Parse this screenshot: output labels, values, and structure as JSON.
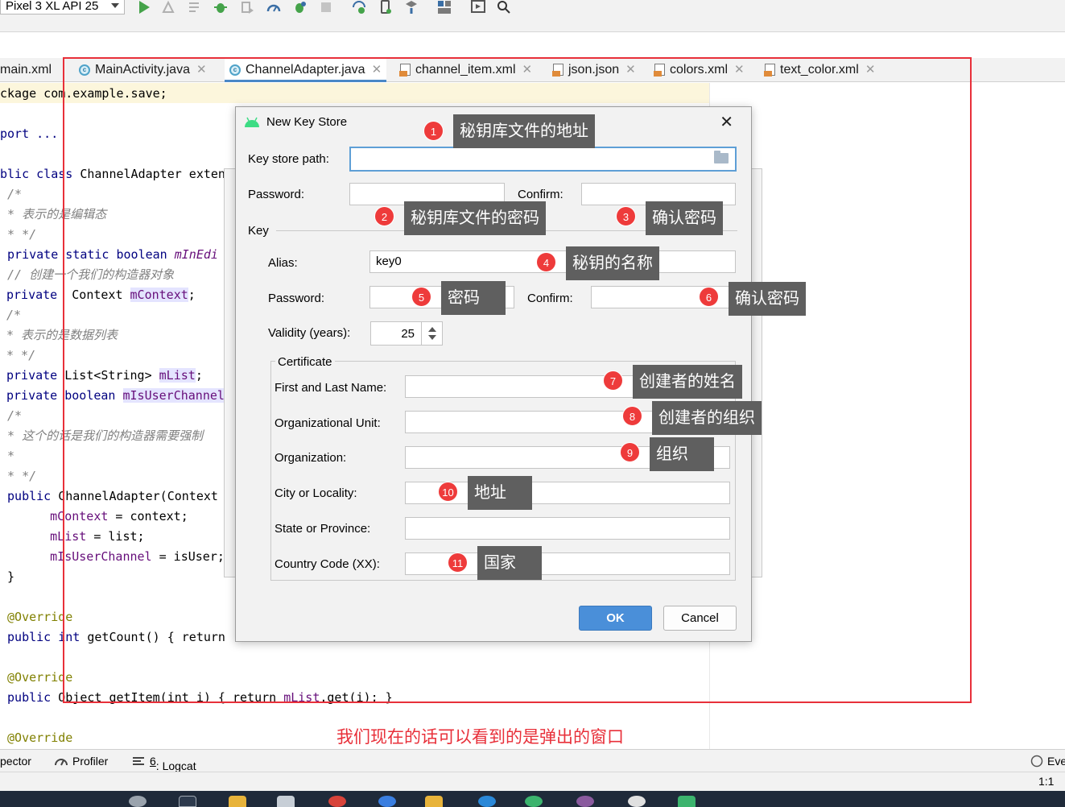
{
  "toolbar": {
    "device": "Pixel 3 XL API 25"
  },
  "tabs": [
    {
      "label": "main.xml",
      "icon": "xml-file-icon"
    },
    {
      "label": "MainActivity.java",
      "icon": "class-icon"
    },
    {
      "label": "ChannelAdapter.java",
      "icon": "class-icon",
      "active": true
    },
    {
      "label": "channel_item.xml",
      "icon": "xml-file-icon"
    },
    {
      "label": "json.json",
      "icon": "json-file-icon"
    },
    {
      "label": "colors.xml",
      "icon": "xml-file-icon"
    },
    {
      "label": "text_color.xml",
      "icon": "xml-file-icon"
    }
  ],
  "code": {
    "l1": "ckage com.example.save;",
    "l2": "port ...",
    "l3a": "blic class ",
    "l3b": "ChannelAdapter exten",
    "l4": " /*",
    "l5": " * 表示的是编辑态",
    "l6": " * */",
    "l7a": " private static boolean ",
    "l7b": "mInEdi",
    "l8": " // 创建一个我们的构造器对象",
    "l9a": "private ",
    "l9b": " Context ",
    "l9c": "mContext",
    "l9d": ";",
    "l10": "/*",
    "l11": "* 表示的是数据列表",
    "l12": "* */",
    "l13a": "private ",
    "l13b": "List<String> ",
    "l13c": "mList",
    "l13d": ";",
    "l14a": "private boolean ",
    "l14b": "mIsUserChannel",
    "l15": " /*",
    "l16": " * 这个的话是我们的构造器需要强制",
    "l17": " *",
    "l18": " * */",
    "l19a": " public ",
    "l19b": "ChannelAdapter(Context",
    "l20a": "     mContext",
    "l20b": " = context;",
    "l21a": "     mList",
    "l21b": " = list;",
    "l22a": "     mIsUserChannel",
    "l22b": " = isUser;",
    "l23": " }",
    "l24": " @Override",
    "l25a": " public int ",
    "l25b": "getCount() { return ",
    "l26": " @Override",
    "l27a": " public ",
    "l27b": "Object getItem(int i) { return ",
    "l27c": "mList",
    "l27d": ".get(i); }",
    "l28": " @Override"
  },
  "dialog": {
    "title": "New Key Store",
    "keystore_path_label": "Key store path:",
    "keystore_path_value": "",
    "password_label": "Password:",
    "confirm_label": "Confirm:",
    "key_section": "Key",
    "alias_label": "Alias:",
    "alias_value": "key0",
    "key_password_label": "Password:",
    "key_confirm_label": "Confirm:",
    "validity_label": "Validity (years):",
    "validity_value": "25",
    "certificate_section": "Certificate",
    "first_last_label": "First and Last Name:",
    "org_unit_label": "Organizational Unit:",
    "org_label": "Organization:",
    "city_label": "City or Locality:",
    "state_label": "State or Province:",
    "country_label": "Country Code (XX):",
    "ok": "OK",
    "cancel": "Cancel"
  },
  "annotations": [
    {
      "n": "1",
      "text": "秘钥库文件的地址"
    },
    {
      "n": "2",
      "text": "秘钥库文件的密码"
    },
    {
      "n": "3",
      "text": "确认密码"
    },
    {
      "n": "4",
      "text": "秘钥的名称"
    },
    {
      "n": "5",
      "text": "密码"
    },
    {
      "n": "6",
      "text": "确认密码"
    },
    {
      "n": "7",
      "text": "创建者的姓名"
    },
    {
      "n": "8",
      "text": "创建者的组织"
    },
    {
      "n": "9",
      "text": "组织"
    },
    {
      "n": "10",
      "text": "地址"
    },
    {
      "n": "11",
      "text": "国家"
    }
  ],
  "caption": "我们现在的话可以看到的是弹出的窗口",
  "statusbar": {
    "inspector": "pector",
    "profiler": "Profiler",
    "logcat_num": "6",
    "logcat": ": Logcat",
    "event": "Eve",
    "position": "1:1"
  },
  "colors": {
    "accent": "#4a8fd9",
    "annotation_red": "#e8303a",
    "tag_bg": "#5f5f5f"
  }
}
